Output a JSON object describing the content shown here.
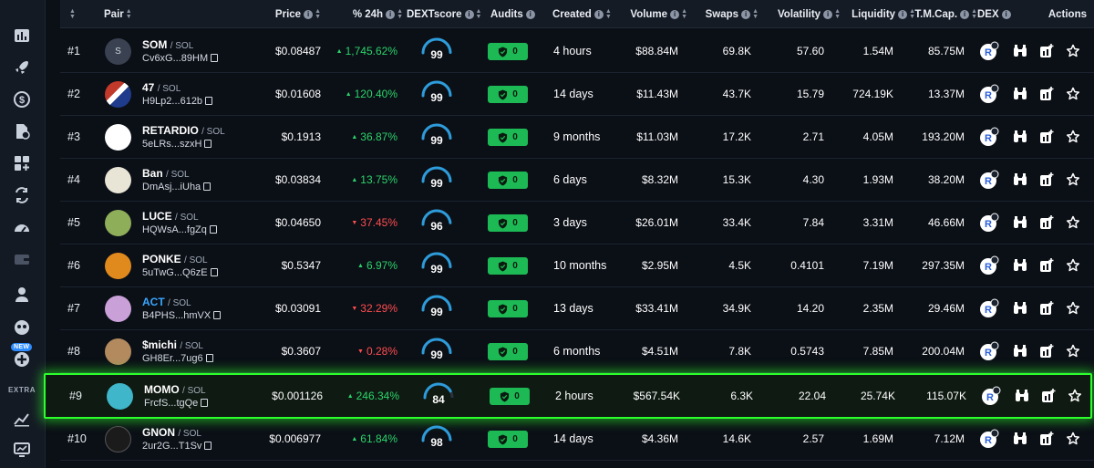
{
  "header": {
    "columns": [
      {
        "key": "pair",
        "label": "Pair",
        "info": false
      },
      {
        "key": "price",
        "label": "Price",
        "info": true
      },
      {
        "key": "change",
        "label": "% 24h",
        "info": true
      },
      {
        "key": "dexscore",
        "label": "DEXTscore",
        "info": true
      },
      {
        "key": "audits",
        "label": "Audits",
        "info": true
      },
      {
        "key": "created",
        "label": "Created",
        "info": true
      },
      {
        "key": "volume",
        "label": "Volume",
        "info": true
      },
      {
        "key": "swaps",
        "label": "Swaps",
        "info": true
      },
      {
        "key": "volatility",
        "label": "Volatility",
        "info": true
      },
      {
        "key": "liquidity",
        "label": "Liquidity",
        "info": true
      },
      {
        "key": "tmcap",
        "label": "T.M.Cap.",
        "info": true
      },
      {
        "key": "dex",
        "label": "DEX",
        "info": true
      },
      {
        "key": "actions",
        "label": "Actions",
        "info": false
      }
    ]
  },
  "sidebar": {
    "new_badge": "NEW",
    "extra_label": "EXTRA",
    "icons": [
      "chart-bars-icon",
      "rocket-icon",
      "dollar-icon",
      "document-dollar-icon",
      "apps-icon",
      "swap-icon",
      "speedometer-icon",
      "wallet-icon",
      "user-icon",
      "mascot-icon",
      "plus-icon",
      "trending-chart-icon",
      "monitor-chart-icon"
    ]
  },
  "rows": [
    {
      "rank": "#1",
      "name": "SOM",
      "chain": "/ SOL",
      "addr": "Cv6xG...89HM",
      "avatar_text": "S",
      "price": "$0.08487",
      "change": "1,745.62%",
      "dir": "up",
      "score": "99",
      "audit": "0",
      "created": "4 hours",
      "volume": "$88.84M",
      "swaps": "69.8K",
      "volatility": "57.60",
      "liquidity": "1.54M",
      "tmcap": "85.75M",
      "highlight": false,
      "name_color": "white"
    },
    {
      "rank": "#2",
      "name": "47",
      "chain": "/ SOL",
      "addr": "H9Lp2...612b",
      "avatar_text": "",
      "price": "$0.01608",
      "change": "120.40%",
      "dir": "up",
      "score": "99",
      "audit": "0",
      "created": "14 days",
      "volume": "$11.43M",
      "swaps": "43.7K",
      "volatility": "15.79",
      "liquidity": "724.19K",
      "tmcap": "13.37M",
      "highlight": false,
      "name_color": "white"
    },
    {
      "rank": "#3",
      "name": "RETARDIO",
      "chain": "/ SOL",
      "addr": "5eLRs...szxH",
      "avatar_text": "",
      "price": "$0.1913",
      "change": "36.87%",
      "dir": "up",
      "score": "99",
      "audit": "0",
      "created": "9 months",
      "volume": "$11.03M",
      "swaps": "17.2K",
      "volatility": "2.71",
      "liquidity": "4.05M",
      "tmcap": "193.20M",
      "highlight": false,
      "name_color": "white"
    },
    {
      "rank": "#4",
      "name": "Ban",
      "chain": "/ SOL",
      "addr": "DmAsj...iUha",
      "avatar_text": "",
      "price": "$0.03834",
      "change": "13.75%",
      "dir": "up",
      "score": "99",
      "audit": "0",
      "created": "6 days",
      "volume": "$8.32M",
      "swaps": "15.3K",
      "volatility": "4.30",
      "liquidity": "1.93M",
      "tmcap": "38.20M",
      "highlight": false,
      "name_color": "white"
    },
    {
      "rank": "#5",
      "name": "LUCE",
      "chain": "/ SOL",
      "addr": "HQWsA...fgZq",
      "avatar_text": "",
      "price": "$0.04650",
      "change": "37.45%",
      "dir": "down",
      "score": "96",
      "audit": "0",
      "created": "3 days",
      "volume": "$26.01M",
      "swaps": "33.4K",
      "volatility": "7.84",
      "liquidity": "3.31M",
      "tmcap": "46.66M",
      "highlight": false,
      "name_color": "white"
    },
    {
      "rank": "#6",
      "name": "PONKE",
      "chain": "/ SOL",
      "addr": "5uTwG...Q6zE",
      "avatar_text": "",
      "price": "$0.5347",
      "change": "6.97%",
      "dir": "up",
      "score": "99",
      "audit": "0",
      "created": "10 months",
      "volume": "$2.95M",
      "swaps": "4.5K",
      "volatility": "0.4101",
      "liquidity": "7.19M",
      "tmcap": "297.35M",
      "highlight": false,
      "name_color": "white"
    },
    {
      "rank": "#7",
      "name": "ACT",
      "chain": "/ SOL",
      "addr": "B4PHS...hmVX",
      "avatar_text": "",
      "price": "$0.03091",
      "change": "32.29%",
      "dir": "down",
      "score": "99",
      "audit": "0",
      "created": "13 days",
      "volume": "$33.41M",
      "swaps": "34.9K",
      "volatility": "14.20",
      "liquidity": "2.35M",
      "tmcap": "29.46M",
      "highlight": false,
      "name_color": "blue"
    },
    {
      "rank": "#8",
      "name": "$michi",
      "chain": "/ SOL",
      "addr": "GH8Er...7ug6",
      "avatar_text": "",
      "price": "$0.3607",
      "change": "0.28%",
      "dir": "down",
      "score": "99",
      "audit": "0",
      "created": "6 months",
      "volume": "$4.51M",
      "swaps": "7.8K",
      "volatility": "0.5743",
      "liquidity": "7.85M",
      "tmcap": "200.04M",
      "highlight": false,
      "name_color": "white"
    },
    {
      "rank": "#9",
      "name": "MOMO",
      "chain": "/ SOL",
      "addr": "FrcfS...tgQe",
      "avatar_text": "",
      "price": "$0.001126",
      "change": "246.34%",
      "dir": "up",
      "score": "84",
      "audit": "0",
      "created": "2 hours",
      "volume": "$567.54K",
      "swaps": "6.3K",
      "volatility": "22.04",
      "liquidity": "25.74K",
      "tmcap": "115.07K",
      "highlight": true,
      "name_color": "white"
    },
    {
      "rank": "#10",
      "name": "GNON",
      "chain": "/ SOL",
      "addr": "2ur2G...T1Sv",
      "avatar_text": "",
      "price": "$0.006977",
      "change": "61.84%",
      "dir": "up",
      "score": "98",
      "audit": "0",
      "created": "14 days",
      "volume": "$4.36M",
      "swaps": "14.6K",
      "volatility": "2.57",
      "liquidity": "1.69M",
      "tmcap": "7.12M",
      "highlight": false,
      "name_color": "white"
    }
  ],
  "colors": {
    "up": "#2bd46a",
    "down": "#ff4d4f",
    "audit": "#1db954",
    "highlight": "#2cff2c",
    "gauge": "#2d9cdb"
  }
}
